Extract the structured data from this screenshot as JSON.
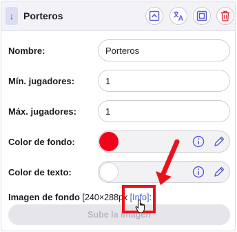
{
  "header": {
    "title": "Porteros"
  },
  "fields": {
    "nombre": {
      "label": "Nombre:",
      "value": "Porteros"
    },
    "min_jugadores": {
      "label": "Mín. jugadores:",
      "value": "1"
    },
    "max_jugadores": {
      "label": "Máx. jugadores:",
      "value": "1"
    },
    "color_fondo": {
      "label": "Color de fondo:",
      "swatch": "#f5001a"
    },
    "color_texto": {
      "label": "Color de texto:",
      "swatch": "#ffffff"
    }
  },
  "imagen": {
    "label": "Imagen de fondo",
    "size": "[240×288px",
    "info": "[Info]",
    "suffix": ":",
    "upload_label": "Sube la imagen"
  },
  "colors": {
    "accent": "#5b5bd6",
    "delete": "#e0303b",
    "annotation": "#e8131c"
  }
}
